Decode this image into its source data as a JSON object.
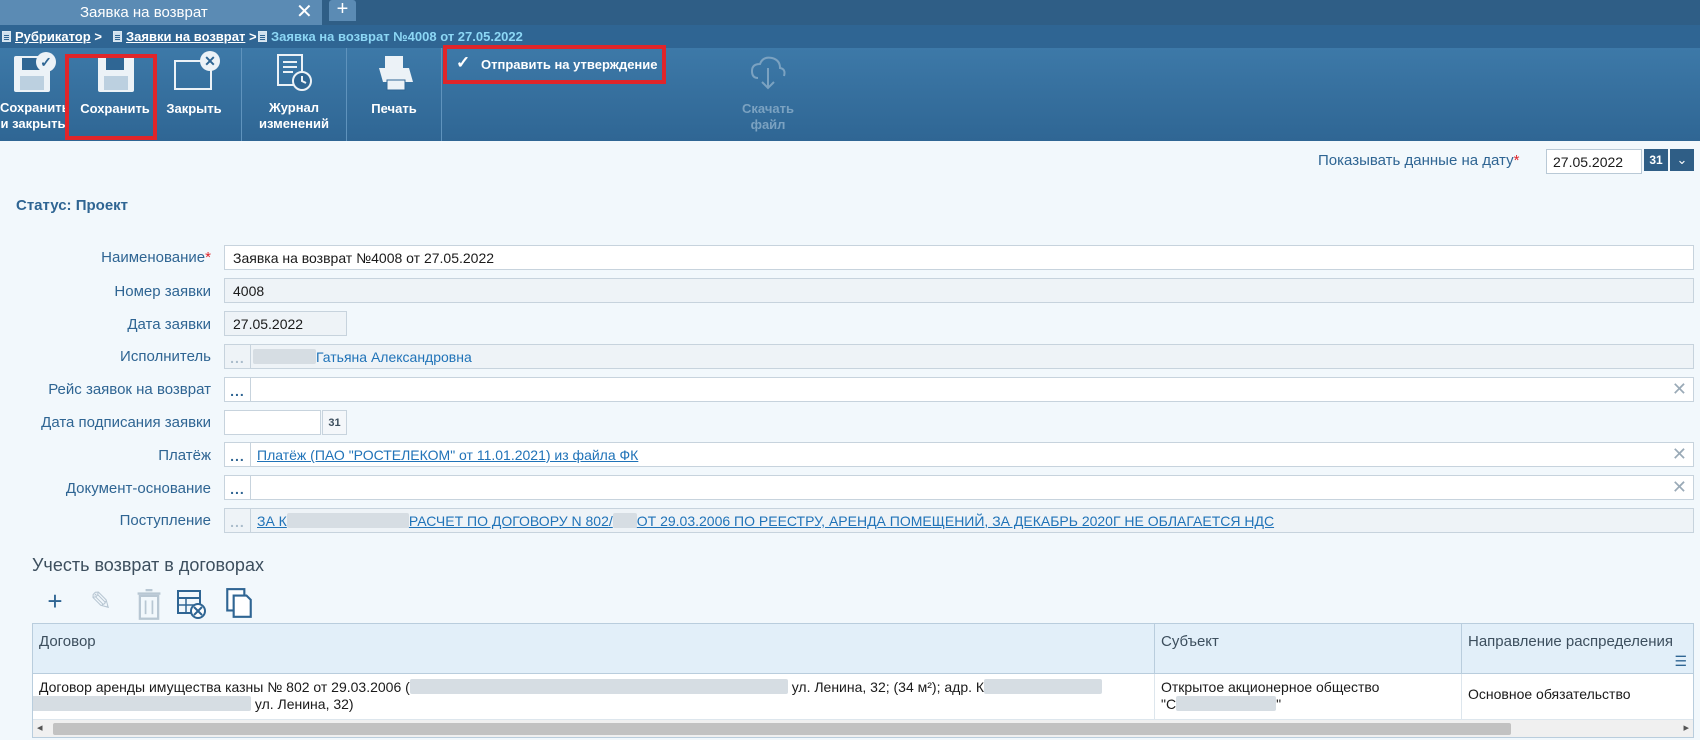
{
  "tab": {
    "title": "Заявка на возврат",
    "close": "✕",
    "add": "+"
  },
  "breadcrumb": {
    "items": [
      "Рубрикатор",
      "Заявки на возврат"
    ],
    "separator": ">",
    "current": "Заявка на возврат №4008 от 27.05.2022"
  },
  "toolbar": {
    "save_close": "Сохранить\nи закрыть",
    "save": "Сохранить",
    "close": "Закрыть",
    "journal": "Журнал\nизменений",
    "print": "Печать",
    "approve": "Отправить на утверждение",
    "download": "Скачать\nфайл"
  },
  "date_filter": {
    "label": "Показывать данные на дату",
    "required": "*",
    "value": "27.05.2022",
    "cal": "31",
    "drop": "⌄"
  },
  "status": "Статус: Проект",
  "form": {
    "name_label": "Наименование",
    "name_required": "*",
    "name_value": "Заявка на возврат №4008 от 27.05.2022",
    "number_label": "Номер заявки",
    "number_value": "4008",
    "date_label": "Дата заявки",
    "date_value": "27.05.2022",
    "executor_label": "Исполнитель",
    "executor_value": "Гатьяна Александровна",
    "trip_label": "Рейс заявок на возврат",
    "sign_date_label": "Дата подписания заявки",
    "sign_cal": "31",
    "payment_label": "Платёж",
    "payment_value": "Платёж (ПАО \"РОСТЕЛЕКОМ\" от 11.01.2021) из файла ФК",
    "basis_label": "Документ-основание",
    "receipt_label": "Поступление",
    "receipt_prefix": "ЗА К",
    "receipt_mid": "РАСЧЕТ ПО ДОГОВОРУ N 802/",
    "receipt_tail": "ОТ 29.03.2006 ПО РЕЕСТРУ, АРЕНДА ПОМЕЩЕНИЙ, ЗА ДЕКАБРЬ 2020Г НЕ ОБЛАГАЕТСЯ НДС",
    "lookup_dots": "...",
    "clear": "✕"
  },
  "contracts": {
    "title": "Учесть возврат в договорах",
    "tools": {
      "add": "+",
      "edit": "✎",
      "delete": "🗑"
    },
    "columns": [
      "Договор",
      "Субъект",
      "Направление распределения"
    ],
    "row": {
      "contract_line1a": "Договор аренды имущества казны № 802 от 29.03.2006 (",
      "contract_line1b": "ул. Ленина, 32; (34 м²); адр. К",
      "contract_line2": "ул. Ленина, 32)",
      "subject_line1": "Открытое акционерное общество",
      "subject_line2a": "\"С",
      "subject_line2b": "\"",
      "direction": "Основное обязательство"
    },
    "menu_icon": "☰"
  }
}
